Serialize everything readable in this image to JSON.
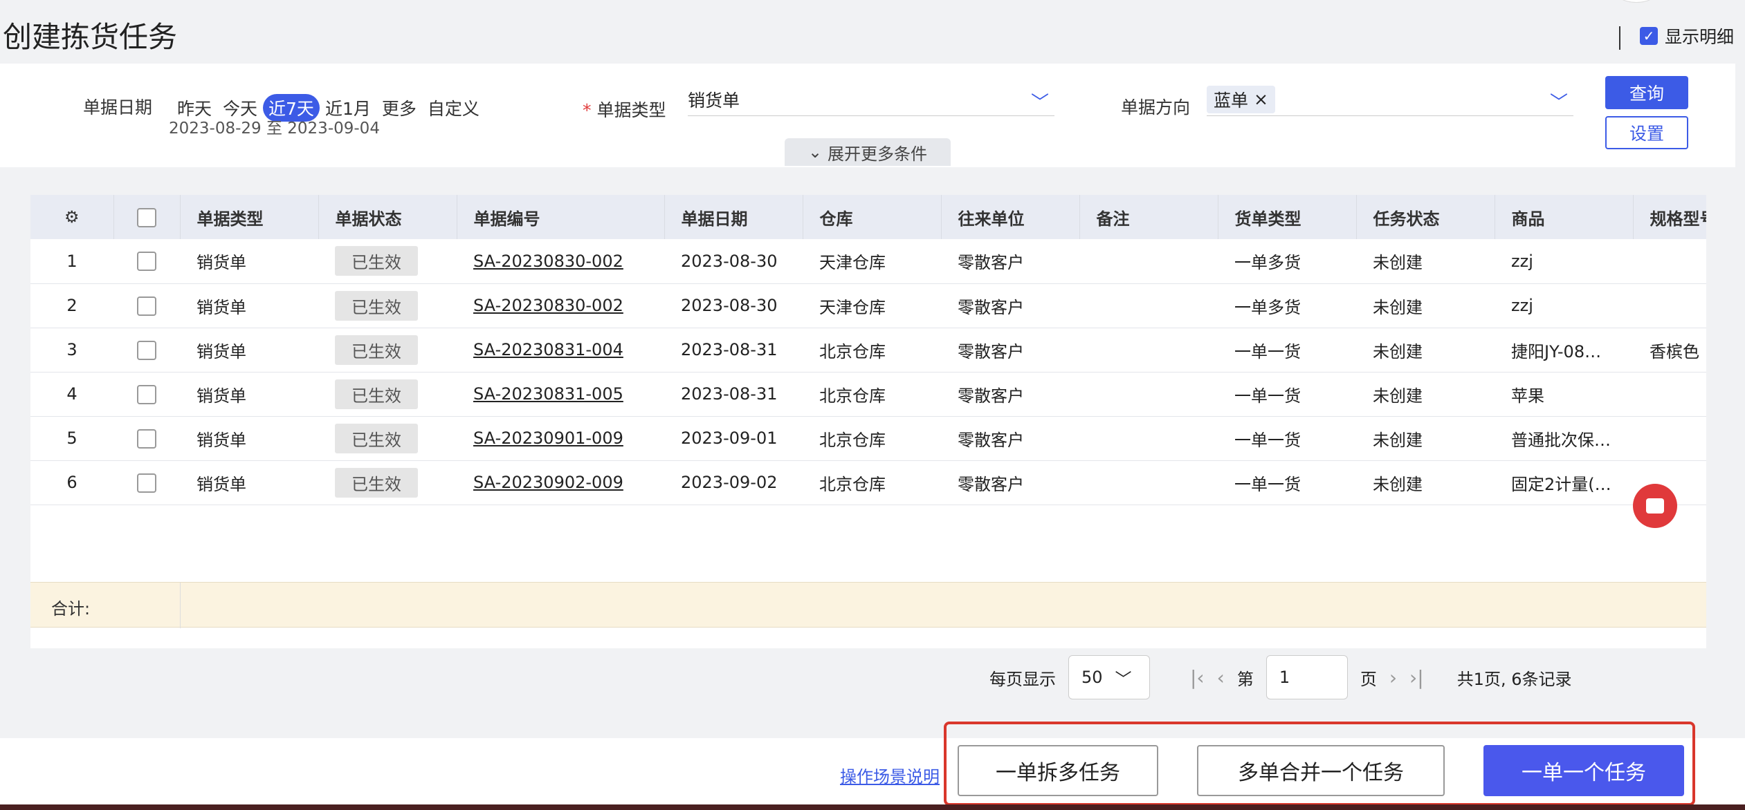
{
  "page": {
    "title": "创建拣货任务",
    "show_detail_label": "显示明细",
    "show_detail_checked": true
  },
  "filters": {
    "date_label": "单据日期",
    "date_options": [
      "昨天",
      "今天",
      "近7天",
      "近1月",
      "更多",
      "自定义"
    ],
    "date_active": "近7天",
    "date_range": "2023-08-29 至 2023-09-04",
    "doc_type_label": "单据类型",
    "doc_type_value": "销货单",
    "direction_label": "单据方向",
    "direction_tag": "蓝单",
    "query_button": "查询",
    "settings_button": "设置",
    "expand_label": "展开更多条件"
  },
  "table": {
    "columns": [
      "单据类型",
      "单据状态",
      "单据编号",
      "单据日期",
      "仓库",
      "往来单位",
      "备注",
      "货单类型",
      "任务状态",
      "商品",
      "规格型号"
    ],
    "rows": [
      {
        "no": "1",
        "type": "销货单",
        "status": "已生效",
        "code": "SA-20230830-002",
        "date": "2023-08-30",
        "warehouse": "天津仓库",
        "partner": "零散客户",
        "remark": "",
        "order_type": "一单多货",
        "task_status": "未创建",
        "goods": "zzj",
        "spec": ""
      },
      {
        "no": "2",
        "type": "销货单",
        "status": "已生效",
        "code": "SA-20230830-002",
        "date": "2023-08-30",
        "warehouse": "天津仓库",
        "partner": "零散客户",
        "remark": "",
        "order_type": "一单多货",
        "task_status": "未创建",
        "goods": "zzj",
        "spec": ""
      },
      {
        "no": "3",
        "type": "销货单",
        "status": "已生效",
        "code": "SA-20230831-004",
        "date": "2023-08-31",
        "warehouse": "北京仓库",
        "partner": "零散客户",
        "remark": "",
        "order_type": "一单一货",
        "task_status": "未创建",
        "goods": "捷阳JY-08…",
        "spec": "香槟色"
      },
      {
        "no": "4",
        "type": "销货单",
        "status": "已生效",
        "code": "SA-20230831-005",
        "date": "2023-08-31",
        "warehouse": "北京仓库",
        "partner": "零散客户",
        "remark": "",
        "order_type": "一单一货",
        "task_status": "未创建",
        "goods": "苹果",
        "spec": ""
      },
      {
        "no": "5",
        "type": "销货单",
        "status": "已生效",
        "code": "SA-20230901-009",
        "date": "2023-09-01",
        "warehouse": "北京仓库",
        "partner": "零散客户",
        "remark": "",
        "order_type": "一单一货",
        "task_status": "未创建",
        "goods": "普通批次保…",
        "spec": ""
      },
      {
        "no": "6",
        "type": "销货单",
        "status": "已生效",
        "code": "SA-20230902-009",
        "date": "2023-09-02",
        "warehouse": "北京仓库",
        "partner": "零散客户",
        "remark": "",
        "order_type": "一单一货",
        "task_status": "未创建",
        "goods": "固定2计量(…",
        "spec": ""
      }
    ],
    "summary_label": "合计:"
  },
  "pagination": {
    "per_page_label": "每页显示",
    "per_page_value": "50",
    "page_prefix": "第",
    "page_value": "1",
    "page_suffix": "页",
    "total_text": "共1页, 6条记录"
  },
  "footer": {
    "scene_link": "操作场景说明",
    "split_button": "一单拆多任务",
    "merge_button": "多单合并一个任务",
    "single_button": "一单一个任务"
  },
  "colors": {
    "primary": "#3c5be6",
    "highlight": "#d9372c",
    "summary_bg": "#fbf3e0"
  }
}
